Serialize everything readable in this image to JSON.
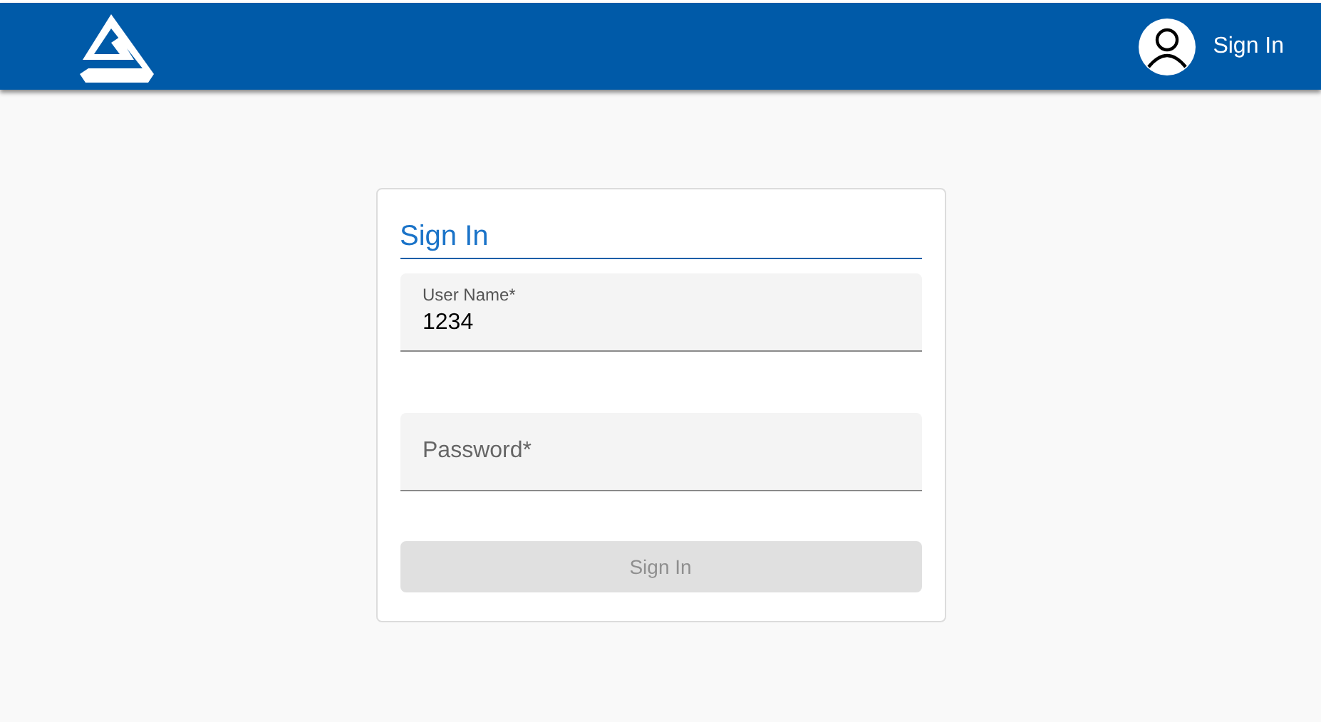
{
  "header": {
    "account_label": "Sign In"
  },
  "card": {
    "title": "Sign In",
    "fields": [
      {
        "label": "User Name*",
        "value": "1234"
      },
      {
        "label": "Password*"
      }
    ],
    "submit": {
      "label": "Sign In",
      "disabled": true
    }
  }
}
